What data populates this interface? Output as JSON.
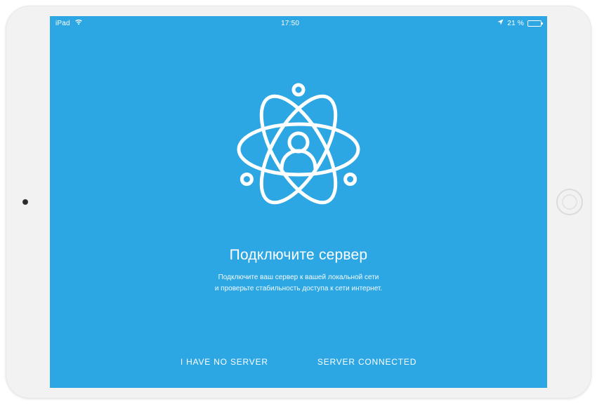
{
  "statusbar": {
    "device_label": "iPad",
    "time": "17:50",
    "battery_text": "21 %"
  },
  "content": {
    "title": "Подключите сервер",
    "subtitle_line1": "Подключите ваш сервер к вашей локальной сети",
    "subtitle_line2": "и проверьте стабильность доступа к сети интернет."
  },
  "footer": {
    "no_server_label": "I HAVE NO SERVER",
    "connected_label": "SERVER CONNECTED"
  },
  "colors": {
    "accent": "#2CA7E4",
    "text": "#FFFFFF"
  }
}
